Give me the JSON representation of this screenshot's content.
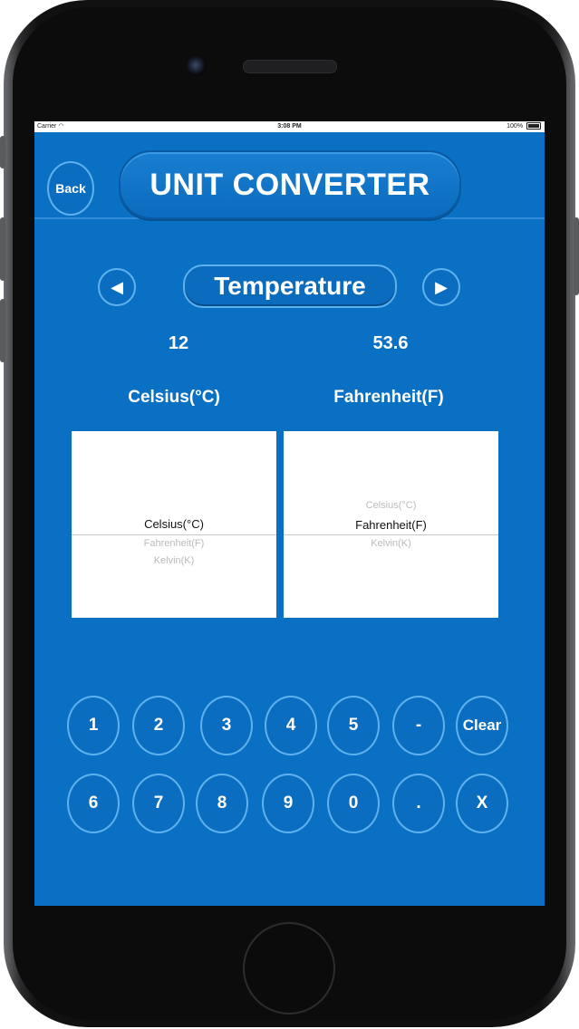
{
  "status_bar": {
    "carrier": "Carrier",
    "time": "3:08 PM",
    "battery": "100%"
  },
  "header": {
    "back_label": "Back",
    "title": "UNIT CONVERTER"
  },
  "category": {
    "prev_icon": "◀",
    "next_icon": "▶",
    "label": "Temperature"
  },
  "values": {
    "from": "12",
    "to": "53.6"
  },
  "units": {
    "from_label": "Celsius(°C)",
    "to_label": "Fahrenheit(F)"
  },
  "from_picker": {
    "options": [
      "Celsius(°C)",
      "Fahrenheit(F)",
      "Kelvin(K)"
    ],
    "selected": "Celsius(°C)"
  },
  "to_picker": {
    "options": [
      "Celsius(°C)",
      "Fahrenheit(F)",
      "Kelvin(K)"
    ],
    "selected": "Fahrenheit(F)"
  },
  "keypad": {
    "row1": [
      "1",
      "2",
      "3",
      "4",
      "5",
      "-",
      "Clear"
    ],
    "row2": [
      "6",
      "7",
      "8",
      "9",
      "0",
      ".",
      "X"
    ]
  },
  "colors": {
    "screen_bg": "#0a70c4",
    "button_border": "#5fb1ee"
  }
}
